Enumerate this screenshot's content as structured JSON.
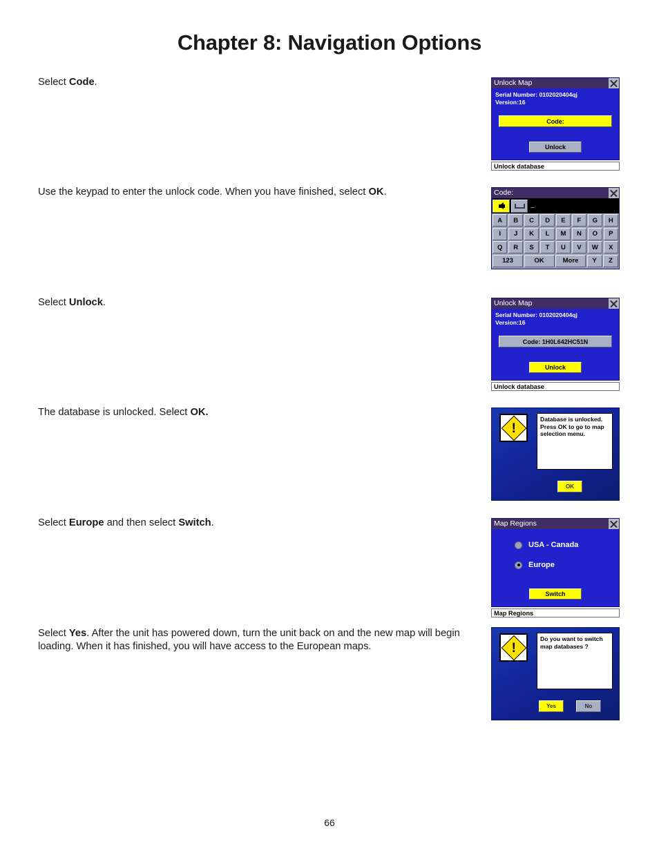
{
  "page": {
    "title": "Chapter 8: Navigation Options",
    "number": "66"
  },
  "steps": [
    {
      "prefix": "Select ",
      "bold": "Code",
      "suffix": "."
    },
    {
      "prefix": "Use the keypad to enter the unlock code. When you have finished, select ",
      "bold": "OK",
      "suffix": "."
    },
    {
      "prefix": "Select ",
      "bold": "Unlock",
      "suffix": "."
    },
    {
      "prefix": "The database is unlocked. Select ",
      "bold": "OK.",
      "suffix": ""
    },
    {
      "prefix": "Select ",
      "bold": "Europe",
      "middle": " and then select ",
      "bold2": "Switch",
      "suffix": "."
    },
    {
      "prefix": "Select ",
      "bold": "Yes",
      "suffix": ". After the unit has powered down, turn the unit back on and the new map will begin loading. When it has finished, you will have access to the European maps."
    }
  ],
  "screens": {
    "unlock_map_empty": {
      "title": "Unlock Map",
      "close_icon": "close-icon",
      "serial": "Serial Number: 0102020404qj",
      "version": "Version:16",
      "code_field": "Code:",
      "code_field_color": "#ffff00",
      "unlock_button": "Unlock",
      "unlock_button_color": "#aab0c4",
      "status": "Unlock database"
    },
    "keypad": {
      "title": "Code:",
      "close_icon": "close-icon",
      "backspace_icon": "backspace-arrow-icon",
      "space_icon": "spacebar-icon",
      "cursor": "_",
      "rows": [
        [
          "A",
          "B",
          "C",
          "D",
          "E",
          "F",
          "G",
          "H"
        ],
        [
          "I",
          "J",
          "K",
          "L",
          "M",
          "N",
          "O",
          "P"
        ],
        [
          "Q",
          "R",
          "S",
          "T",
          "U",
          "V",
          "W",
          "X"
        ]
      ],
      "bottom_row": [
        "123",
        "OK",
        "More",
        "Y",
        "Z"
      ]
    },
    "unlock_map_filled": {
      "title": "Unlock Map",
      "close_icon": "close-icon",
      "serial": "Serial Number: 0102020404qj",
      "version": "Version:16",
      "code_field": "Code: 1H0L642HC51N",
      "code_field_color": "#aab0c4",
      "unlock_button": "Unlock",
      "unlock_button_color": "#ffff00",
      "status": "Unlock database"
    },
    "unlocked_alert": {
      "warning_icon": "warning-exclamation-icon",
      "message": "Database is unlocked. Press OK to go to map selection menu.",
      "buttons": [
        {
          "label": "OK",
          "color": "#ffff00"
        }
      ]
    },
    "map_regions": {
      "title": "Map Regions",
      "close_icon": "close-icon",
      "options": [
        {
          "label": "USA - Canada",
          "selected": false
        },
        {
          "label": "Europe",
          "selected": true
        }
      ],
      "switch_button": "Switch",
      "switch_button_color": "#ffff00",
      "status": "Map Regions"
    },
    "confirm_alert": {
      "warning_icon": "warning-exclamation-icon",
      "message": "Do you want to switch map databases ?",
      "buttons": [
        {
          "label": "Yes",
          "color": "#ffff00"
        },
        {
          "label": "No",
          "color": "#aab0c4"
        }
      ]
    }
  }
}
